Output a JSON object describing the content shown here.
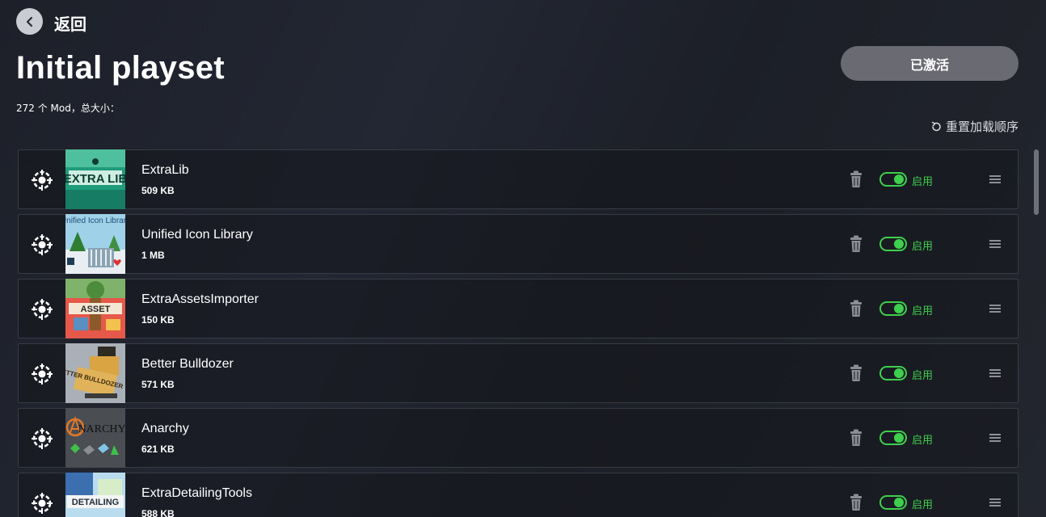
{
  "header": {
    "back_label": "返回",
    "title": "Initial playset",
    "subtitle": "272 个 Mod，总大小：",
    "activated_label": "已激活",
    "reset_order_label": "重置加载顺序"
  },
  "colors": {
    "accent_green": "#3ecf4d",
    "activated_button_bg": "#6a6a73",
    "row_border": "#383b44"
  },
  "mods": [
    {
      "name": "ExtraLib",
      "size": "509 KB",
      "enabled_label": "启用",
      "enabled": true,
      "thumbnail_text": "EXTRA LIB",
      "thumbnail_icon": "extralib-thumbnail"
    },
    {
      "name": "Unified Icon Library",
      "size": "1 MB",
      "enabled_label": "启用",
      "enabled": true,
      "thumbnail_text": "Unified Icon Library",
      "thumbnail_icon": "unified-icon-library-thumbnail"
    },
    {
      "name": "ExtraAssetsImporter",
      "size": "150 KB",
      "enabled_label": "启用",
      "enabled": true,
      "thumbnail_text": "ASSET",
      "thumbnail_icon": "extra-assets-importer-thumbnail"
    },
    {
      "name": "Better Bulldozer",
      "size": "571 KB",
      "enabled_label": "启用",
      "enabled": true,
      "thumbnail_text": "BETTER BULLDOZER",
      "thumbnail_icon": "better-bulldozer-thumbnail"
    },
    {
      "name": "Anarchy",
      "size": "621 KB",
      "enabled_label": "启用",
      "enabled": true,
      "thumbnail_text": "NARCHY",
      "thumbnail_icon": "anarchy-thumbnail"
    },
    {
      "name": "ExtraDetailingTools",
      "size": "588 KB",
      "enabled_label": "启用",
      "enabled": true,
      "thumbnail_text": "DETAILING",
      "thumbnail_icon": "extra-detailing-tools-thumbnail"
    }
  ],
  "icons": {
    "back": "chevron-left-icon",
    "reset": "refresh-icon",
    "mod_source": "paradox-mods-icon",
    "delete": "trash-icon",
    "drag": "drag-handle-icon"
  }
}
